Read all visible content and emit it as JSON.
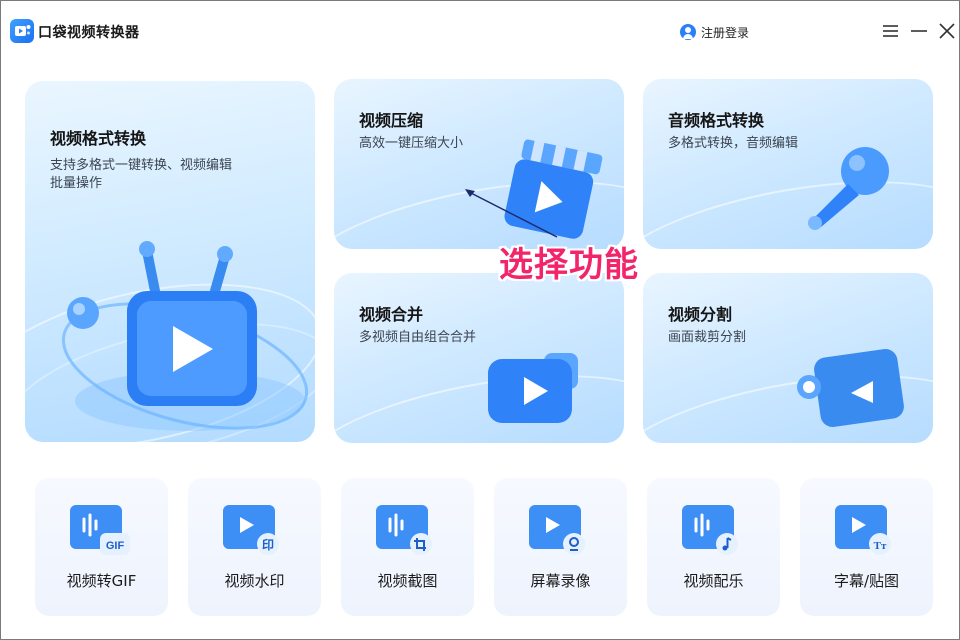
{
  "app": {
    "title": "口袋视频转换器"
  },
  "header": {
    "login_label": "注册登录"
  },
  "colors": {
    "accent": "#2d7ff9",
    "overlay_text": "#f2246a",
    "card_bg": "#cfe9ff"
  },
  "cards": {
    "video_format": {
      "title": "视频格式转换",
      "desc_line1": "支持多格式一键转换、视频编辑",
      "desc_line2": "批量操作"
    },
    "compress": {
      "title": "视频压缩",
      "desc": "高效一键压缩大小"
    },
    "audio_format": {
      "title": "音频格式转换",
      "desc": "多格式转换，音频编辑"
    },
    "merge": {
      "title": "视频合并",
      "desc": "多视频自由组合合并"
    },
    "split": {
      "title": "视频分割",
      "desc": "画面裁剪分割"
    }
  },
  "tools": [
    {
      "label": "视频转GIF",
      "badge": "GIF",
      "icon": "gif-icon"
    },
    {
      "label": "视频水印",
      "badge": "印",
      "icon": "watermark-icon"
    },
    {
      "label": "视频截图",
      "badge": "crop",
      "icon": "screenshot-icon"
    },
    {
      "label": "屏幕录像",
      "badge": "cam",
      "icon": "screen-record-icon"
    },
    {
      "label": "视频配乐",
      "badge": "note",
      "icon": "music-icon"
    },
    {
      "label": "字幕/贴图",
      "badge": "Tт",
      "icon": "subtitle-icon"
    }
  ],
  "overlay": {
    "text": "选择功能"
  }
}
